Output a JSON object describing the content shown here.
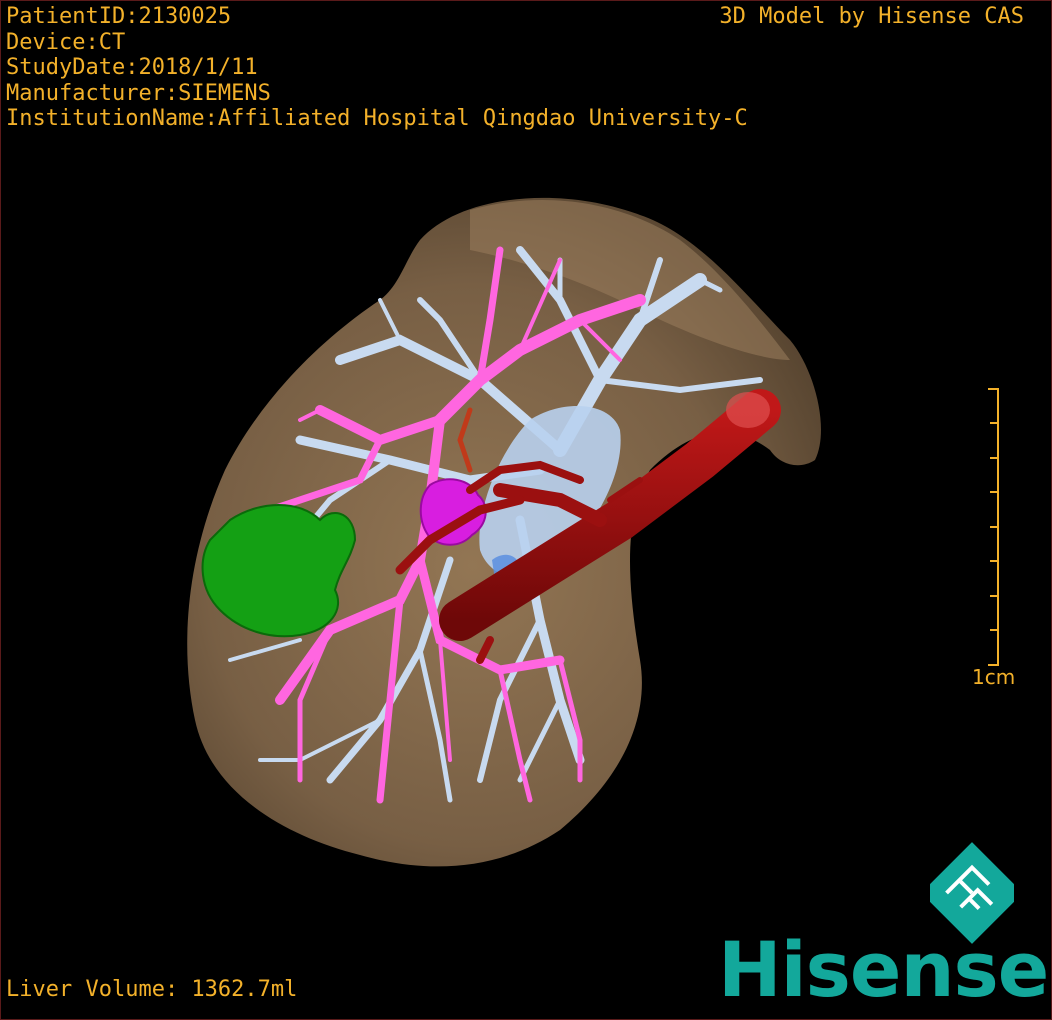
{
  "patient_info": {
    "patient_id": "PatientID:2130025",
    "device": "Device:CT",
    "study_date": "StudyDate:2018/1/11",
    "manufacturer": "Manufacturer:SIEMENS",
    "institution": "InstitutionName:Affiliated Hospital Qingdao University-C"
  },
  "credit": "3D Model by Hisense CAS",
  "liver_volume": "Liver Volume: 1362.7ml",
  "scale_bar": {
    "label": "1cm"
  },
  "brand": {
    "name": "Hisense"
  },
  "colors": {
    "text": "#f3b12a",
    "liver": "#8a6e4e",
    "portal_vein": "#ff66e0",
    "hepatic_vein": "#c8daf0",
    "artery": "#9b1010",
    "tumor": "#14a014",
    "gallbladder": "#d81ee0",
    "brand": "#13a89b"
  },
  "model_parts": [
    "liver-surface",
    "hepatic-veins",
    "portal-veins",
    "inferior-vena-cava",
    "tumor",
    "gallbladder"
  ]
}
